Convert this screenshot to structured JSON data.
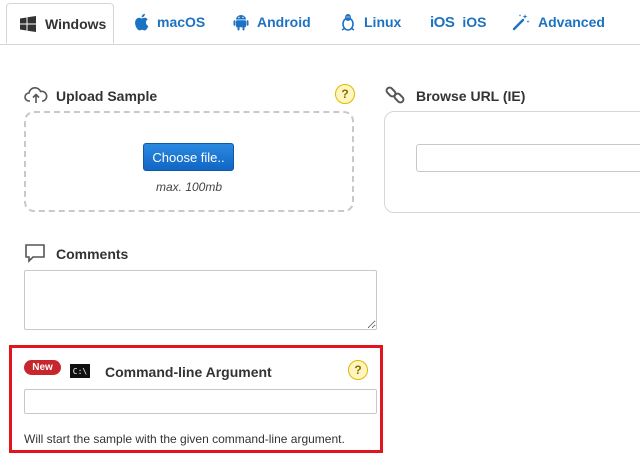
{
  "tabs": [
    {
      "label": "Windows",
      "icon": "windows-icon",
      "active": true
    },
    {
      "label": "macOS",
      "icon": "apple-icon",
      "active": false
    },
    {
      "label": "Android",
      "icon": "android-icon",
      "active": false
    },
    {
      "label": "Linux",
      "icon": "linux-icon",
      "active": false
    },
    {
      "label": "iOS",
      "icon": "ios-icon",
      "icon_text": "iOS",
      "active": false
    },
    {
      "label": "Advanced",
      "icon": "magic-wand-icon",
      "active": false
    }
  ],
  "upload": {
    "label": "Upload Sample",
    "button_label": "Choose file..",
    "max_size": "max. 100mb",
    "help": "?"
  },
  "browse_url": {
    "label": "Browse URL (IE)",
    "value": ""
  },
  "comments": {
    "label": "Comments",
    "value": ""
  },
  "command_line": {
    "badge": "New",
    "icon_text": "C:\\",
    "label": "Command-line Argument",
    "help": "?",
    "value": "",
    "hint": "Will start the sample with the given command-line argument."
  },
  "colors": {
    "accent": "#1d72c2",
    "highlight_frame": "#e0151d",
    "badge": "#c6262d",
    "help_bg": "#fff5bf"
  }
}
